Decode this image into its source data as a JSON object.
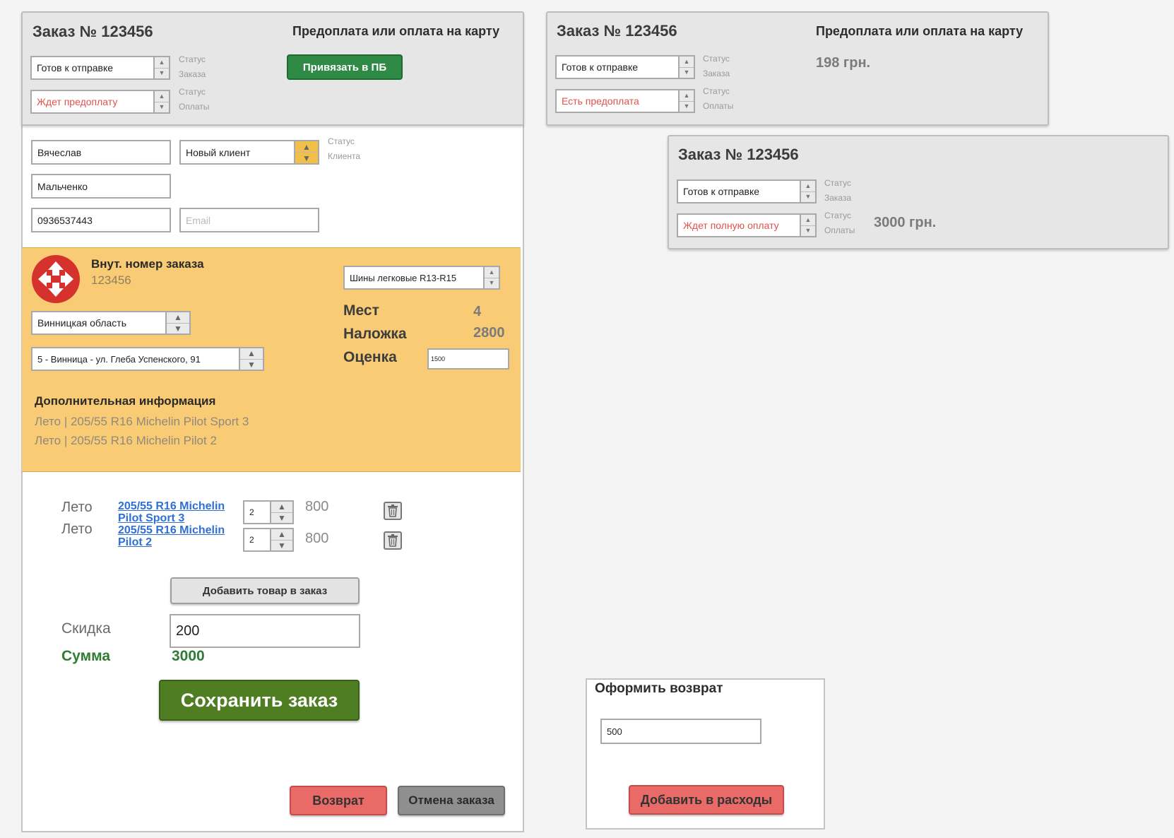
{
  "main_order": {
    "title": "Заказ № 123456",
    "payment_heading": "Предоплата или оплата на карту",
    "order_status": "Готов к отправке",
    "order_status_label_1": "Статус",
    "order_status_label_2": "Заказа",
    "payment_status": "Ждет предоплату",
    "payment_status_label_1": "Статус",
    "payment_status_label_2": "Оплаты",
    "bind_pb_button": "Привязать в ПБ"
  },
  "client": {
    "first_name": "Вячеслав",
    "last_name": "Мальченко",
    "phone": "0936537443",
    "email_placeholder": "Email",
    "client_status": "Новый клиент",
    "client_status_label_1": "Статус",
    "client_status_label_2": "Клиента"
  },
  "delivery": {
    "internal_number_label": "Внут. номер заказа",
    "internal_number": "123456",
    "region": "Винницкая область",
    "branch": "5 - Винница - ул. Глеба Успенского, 91",
    "cargo_type": "Шины легковые R13-R15",
    "places_label": "Мест",
    "places_value": "4",
    "cod_label": "Наложка",
    "cod_value": "2800",
    "valuation_label": "Оценка",
    "valuation_value": "1500",
    "extra_info_label": "Дополнительная информация",
    "extra_info_lines": [
      "Лето | 205/55 R16 Michelin Pilot Sport 3",
      "Лето | 205/55 R16 Michelin Pilot 2"
    ]
  },
  "items": [
    {
      "season": "Лето",
      "name_line1": "205/55 R16 Michelin",
      "name_line2": "Pilot Sport 3",
      "qty": "2",
      "price": "800"
    },
    {
      "season": "Лето",
      "name_line1": "205/55 R16 Michelin",
      "name_line2": "Pilot 2",
      "qty": "2",
      "price": "800"
    }
  ],
  "totals": {
    "add_item_button": "Добавить товар в заказ",
    "discount_label": "Скидка",
    "discount_value": "200",
    "sum_label": "Сумма",
    "sum_value": "3000",
    "save_button": "Сохранить заказ",
    "return_button": "Возврат",
    "cancel_button": "Отмена заказа"
  },
  "order_variant_prepaid": {
    "title": "Заказ № 123456",
    "payment_heading": "Предоплата или оплата на карту",
    "amount": "198 грн.",
    "order_status": "Готов к отправке",
    "order_status_label_1": "Статус",
    "order_status_label_2": "Заказа",
    "payment_status": "Есть предоплата",
    "payment_status_label_1": "Статус",
    "payment_status_label_2": "Оплаты"
  },
  "order_variant_full": {
    "title": "Заказ № 123456",
    "order_status": "Готов к отправке",
    "order_status_label_1": "Статус",
    "order_status_label_2": "Заказа",
    "payment_status": "Ждет полную оплату",
    "payment_status_label_1": "Статус",
    "payment_status_label_2": "Оплаты",
    "amount": "3000 грн."
  },
  "refund": {
    "title": "Оформить возврат",
    "amount": "500",
    "add_expense_button": "Добавить в расходы"
  },
  "colors": {
    "delivery_panel": "#f8cb74",
    "accent_green": "#2f8a45",
    "save_green": "#4f7d21",
    "return_red": "#e96a66",
    "status_red": "#e0524d",
    "link_blue": "#2f6fd6"
  }
}
